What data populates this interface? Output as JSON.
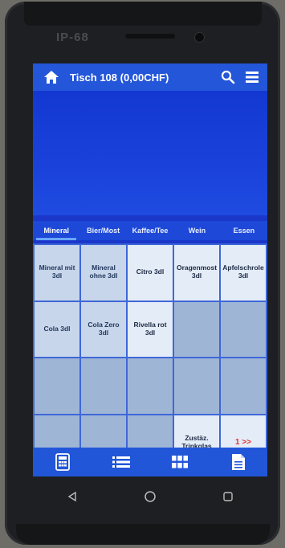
{
  "device": {
    "brand": "IP-68"
  },
  "appbar": {
    "title": "Tisch 108 (0,00CHF)"
  },
  "tabs": [
    {
      "label": "Mineral",
      "active": true
    },
    {
      "label": "Bier/Most",
      "active": false
    },
    {
      "label": "Kaffee/Tee",
      "active": false
    },
    {
      "label": "Wein",
      "active": false
    },
    {
      "label": "Essen",
      "active": false
    }
  ],
  "products": [
    [
      "Mineral mit 3dl",
      "Mineral ohne 3dl",
      "Citro 3dl",
      "Oragenmost 3dl",
      "Apfelschrole 3dl"
    ],
    [
      "Cola 3dl",
      "Cola Zero 3dl",
      "Rivella rot 3dl",
      "",
      ""
    ],
    [
      "",
      "",
      "",
      "",
      ""
    ],
    [
      "",
      "",
      "",
      "Zustäz. Trinkglas",
      "1 >>"
    ]
  ],
  "colors": {
    "accent": "#2356d8",
    "screen_bg": "#1a37c9",
    "cell_bg": "#c7d6ea",
    "next_text": "#e03030"
  },
  "icons": {
    "home": "home-icon",
    "search": "search-icon",
    "menu": "menu-icon",
    "calculator": "calculator-icon",
    "list": "list-icon",
    "grid": "grid-icon",
    "document": "document-icon"
  }
}
